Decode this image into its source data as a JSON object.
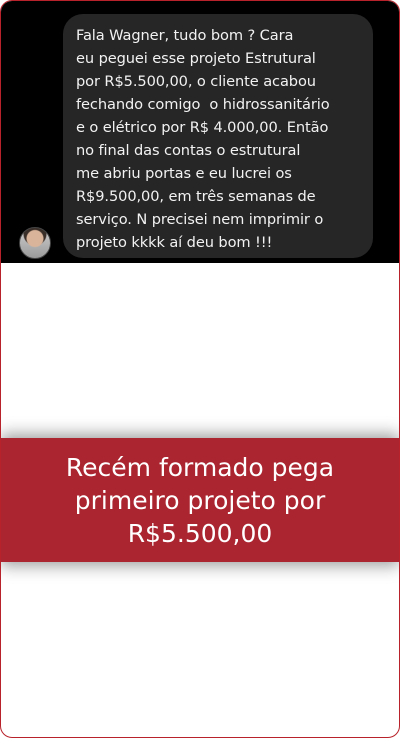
{
  "chat": {
    "message_lines": [
      "Fala Wagner, tudo bom ? Cara",
      "eu peguei esse projeto Estrutural",
      "por R$5.500,00, o cliente acabou",
      "fechando comigo  o hidrossanitário",
      "e o elétrico por R$ 4.000,00. Então",
      "no final das contas o estrutural",
      "me abriu portas e eu lucrei os",
      "R$9.500,00, em três semanas de",
      "serviço. N precisei nem imprimir o",
      "projeto kkkk aí deu bom !!!"
    ]
  },
  "banner": {
    "lines": [
      "Recém formado pega",
      "primeiro projeto por",
      "R$5.500,00"
    ]
  },
  "colors": {
    "accent": "#aa2530",
    "border": "#b8232b",
    "chat_background": "#000000",
    "bubble_background": "#262626"
  },
  "icons": {
    "avatar": "user-avatar-photo"
  }
}
